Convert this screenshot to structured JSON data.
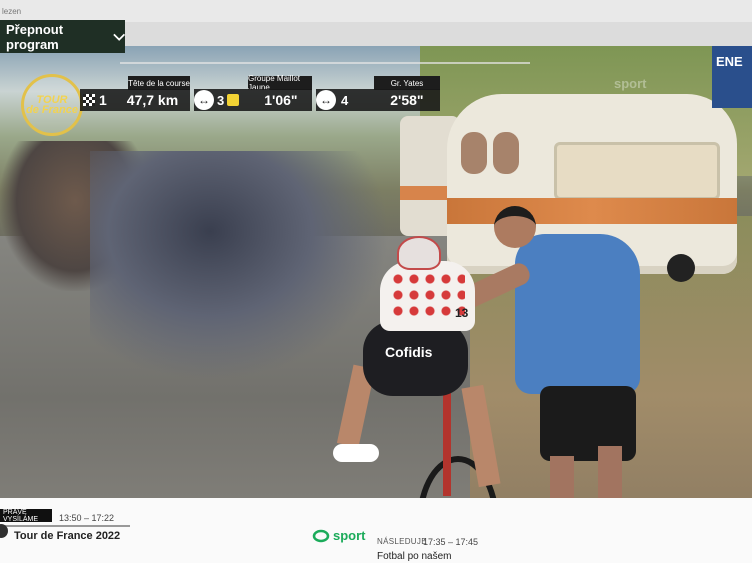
{
  "topbar": {
    "breadcrumb": "lezen"
  },
  "program_switch": {
    "label": "Přepnout program",
    "icon": "chevron-down-icon"
  },
  "overlay": {
    "logo_text_1": "TOUR",
    "logo_text_2": "de France",
    "head_label": "Tête de la course",
    "head_count": "1",
    "head_distance": "47,7 km",
    "group_label": "Groupe Maillot Jaune",
    "group_count": "3",
    "group_gap": "1'06\"",
    "yates_label": "Gr. Yates",
    "yates_count": "4",
    "yates_gap": "2'58\""
  },
  "scene": {
    "rider_sponsor": "Cofidis",
    "rider_bib": "13",
    "watermark": "sport",
    "ad_text": "ENE"
  },
  "now_playing": {
    "badge": "PRÁVĚ VYSÍLÁME",
    "time": "13:50 – 17:22",
    "title": "Tour de France 2022"
  },
  "channel": {
    "name": "sport",
    "color": "#1bab5a"
  },
  "next": {
    "label": "NÁSLEDUJE",
    "time": "17:35 – 17:45",
    "title": "Fotbal po našem"
  }
}
